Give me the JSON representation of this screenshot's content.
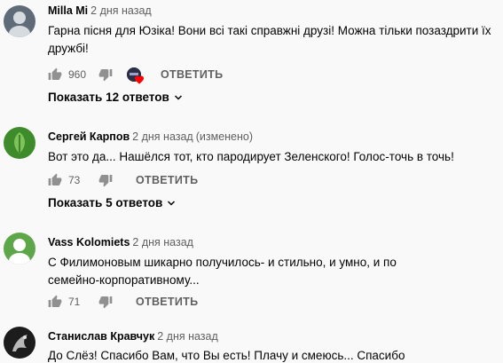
{
  "comments": [
    {
      "author": "Milla Mi",
      "time": "2 дня назад",
      "edited": "",
      "text": "Гарна пісня для Юзіка! Вони всі такі справжні друзі! Можна тільки позаздрити їх дружбі!",
      "likes": "960",
      "reply_label": "ОТВЕТИТЬ",
      "replies_label": "Показать 12 ответов",
      "avatar_color": "#5f6b78",
      "has_creator_heart": true
    },
    {
      "author": "Сергей Карпов",
      "time": "2 дня назад",
      "edited": "(изменено)",
      "text": "Вот это да... Нашёлся тот, кто пародирует Зеленского! Голос-точь в точь!",
      "likes": "73",
      "reply_label": "ОТВЕТИТЬ",
      "replies_label": "Показать 5 ответов",
      "avatar_color": "#3d8b2a",
      "has_creator_heart": false
    },
    {
      "author": "Vass Kolomiets",
      "time": "2 дня назад",
      "edited": "",
      "text": "С Филимоновым шикарно получилось- и стильно, и умно, и по семейно-корпоративному...",
      "likes": "71",
      "reply_label": "ОТВЕТИТЬ",
      "replies_label": "",
      "avatar_color": "#5ea64a",
      "has_creator_heart": false
    },
    {
      "author": "Станислав Кравчук",
      "time": "2 дня назад",
      "edited": "",
      "text": "До Слёз! Спасибо Вам, что Вы есть! Плачу и смеюсь... Спасибо",
      "likes": "",
      "reply_label": "",
      "replies_label": "",
      "avatar_color": "#1c1c1c",
      "has_creator_heart": false
    }
  ],
  "colors": {
    "background": "#f9f9f9",
    "text_primary": "#030303",
    "text_secondary": "#606060",
    "heart": "#ff0000"
  },
  "icons": {
    "like": "thumb-up-icon",
    "dislike": "thumb-down-icon",
    "chevron": "chevron-down-icon",
    "creator_heart": "creator-heart-icon"
  }
}
